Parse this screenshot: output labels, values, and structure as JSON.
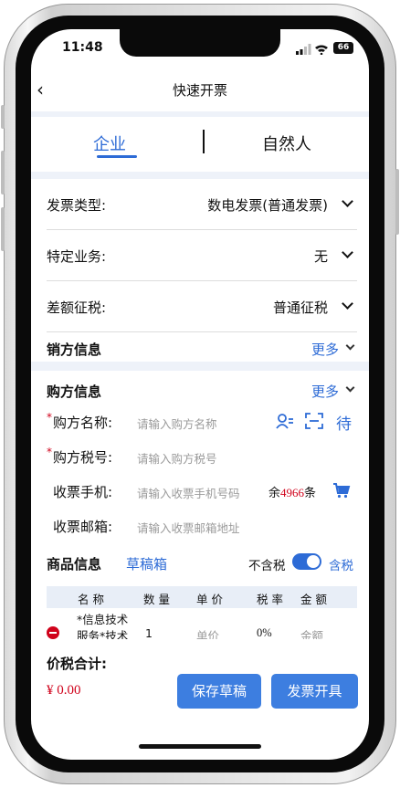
{
  "status": {
    "time": "11:48",
    "battery": "66"
  },
  "nav": {
    "back": "‹",
    "title": "快速开票"
  },
  "tabs": [
    {
      "label": "企业"
    },
    {
      "label": "自然人"
    }
  ],
  "fields": {
    "invoice_type": {
      "label": "发票类型:",
      "value": "数电发票(普通发票)"
    },
    "special_business": {
      "label": "特定业务:",
      "value": "无"
    },
    "tax_method": {
      "label": "差额征税:",
      "value": "普通征税"
    }
  },
  "seller": {
    "title": "销方信息",
    "more": "更多"
  },
  "buyer": {
    "title": "购方信息",
    "more": "更多",
    "required_mark": "*",
    "name": {
      "label": "购方名称:",
      "placeholder": "请输入购方名称"
    },
    "tax_no": {
      "label": "购方税号:",
      "placeholder": "请输入购方税号"
    },
    "phone": {
      "label": "收票手机:",
      "placeholder": "请输入收票手机号码",
      "remain_prefix": "余",
      "remain_count": "4966",
      "remain_suffix": "条"
    },
    "email": {
      "label": "收票邮箱:",
      "placeholder": "请输入收票邮箱地址"
    },
    "pending_label": "待"
  },
  "goods": {
    "title": "商品信息",
    "draft_box": "草稿箱",
    "toggle_off_label": "不含税",
    "toggle_on_label": "含税",
    "toggle_on": true,
    "columns": [
      "名 称",
      "数 量",
      "单 价",
      "税 率",
      "金 额"
    ],
    "row": {
      "name_line1": "*信息技术",
      "name_line2": "服务*技术",
      "qty": "1",
      "price": "单价",
      "rate": "0%",
      "amount": "金额"
    }
  },
  "total": {
    "label": "价税合计:",
    "amount": "¥ 0.00"
  },
  "actions": {
    "save_draft": "保存草稿",
    "issue": "发票开具"
  },
  "colors": {
    "accent": "#2d6bd6",
    "button": "#3d7ee0",
    "required": "#d0021b",
    "amount": "#d0021b"
  }
}
